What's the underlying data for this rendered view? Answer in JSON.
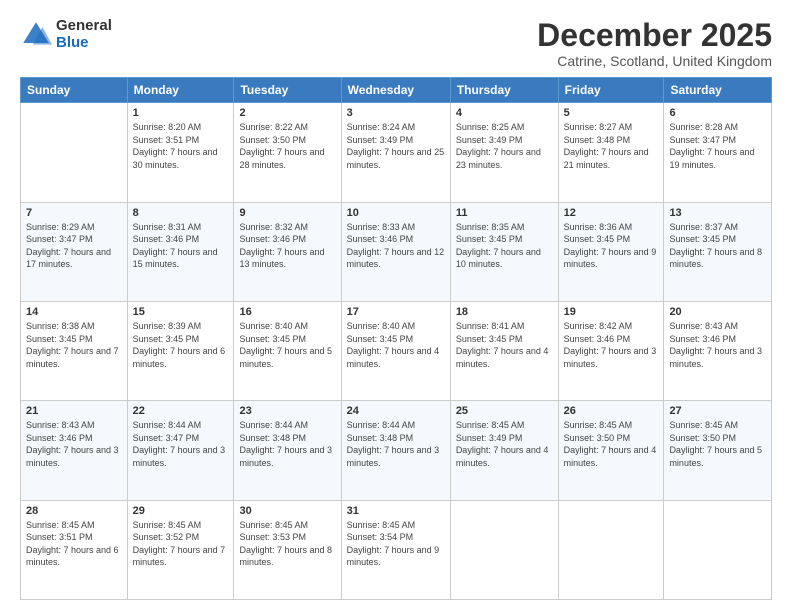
{
  "logo": {
    "general": "General",
    "blue": "Blue"
  },
  "header": {
    "title": "December 2025",
    "subtitle": "Catrine, Scotland, United Kingdom"
  },
  "days": [
    "Sunday",
    "Monday",
    "Tuesday",
    "Wednesday",
    "Thursday",
    "Friday",
    "Saturday"
  ],
  "weeks": [
    [
      {
        "day": "",
        "sunrise": "",
        "sunset": "",
        "daylight": ""
      },
      {
        "day": "1",
        "sunrise": "Sunrise: 8:20 AM",
        "sunset": "Sunset: 3:51 PM",
        "daylight": "Daylight: 7 hours and 30 minutes."
      },
      {
        "day": "2",
        "sunrise": "Sunrise: 8:22 AM",
        "sunset": "Sunset: 3:50 PM",
        "daylight": "Daylight: 7 hours and 28 minutes."
      },
      {
        "day": "3",
        "sunrise": "Sunrise: 8:24 AM",
        "sunset": "Sunset: 3:49 PM",
        "daylight": "Daylight: 7 hours and 25 minutes."
      },
      {
        "day": "4",
        "sunrise": "Sunrise: 8:25 AM",
        "sunset": "Sunset: 3:49 PM",
        "daylight": "Daylight: 7 hours and 23 minutes."
      },
      {
        "day": "5",
        "sunrise": "Sunrise: 8:27 AM",
        "sunset": "Sunset: 3:48 PM",
        "daylight": "Daylight: 7 hours and 21 minutes."
      },
      {
        "day": "6",
        "sunrise": "Sunrise: 8:28 AM",
        "sunset": "Sunset: 3:47 PM",
        "daylight": "Daylight: 7 hours and 19 minutes."
      }
    ],
    [
      {
        "day": "7",
        "sunrise": "Sunrise: 8:29 AM",
        "sunset": "Sunset: 3:47 PM",
        "daylight": "Daylight: 7 hours and 17 minutes."
      },
      {
        "day": "8",
        "sunrise": "Sunrise: 8:31 AM",
        "sunset": "Sunset: 3:46 PM",
        "daylight": "Daylight: 7 hours and 15 minutes."
      },
      {
        "day": "9",
        "sunrise": "Sunrise: 8:32 AM",
        "sunset": "Sunset: 3:46 PM",
        "daylight": "Daylight: 7 hours and 13 minutes."
      },
      {
        "day": "10",
        "sunrise": "Sunrise: 8:33 AM",
        "sunset": "Sunset: 3:46 PM",
        "daylight": "Daylight: 7 hours and 12 minutes."
      },
      {
        "day": "11",
        "sunrise": "Sunrise: 8:35 AM",
        "sunset": "Sunset: 3:45 PM",
        "daylight": "Daylight: 7 hours and 10 minutes."
      },
      {
        "day": "12",
        "sunrise": "Sunrise: 8:36 AM",
        "sunset": "Sunset: 3:45 PM",
        "daylight": "Daylight: 7 hours and 9 minutes."
      },
      {
        "day": "13",
        "sunrise": "Sunrise: 8:37 AM",
        "sunset": "Sunset: 3:45 PM",
        "daylight": "Daylight: 7 hours and 8 minutes."
      }
    ],
    [
      {
        "day": "14",
        "sunrise": "Sunrise: 8:38 AM",
        "sunset": "Sunset: 3:45 PM",
        "daylight": "Daylight: 7 hours and 7 minutes."
      },
      {
        "day": "15",
        "sunrise": "Sunrise: 8:39 AM",
        "sunset": "Sunset: 3:45 PM",
        "daylight": "Daylight: 7 hours and 6 minutes."
      },
      {
        "day": "16",
        "sunrise": "Sunrise: 8:40 AM",
        "sunset": "Sunset: 3:45 PM",
        "daylight": "Daylight: 7 hours and 5 minutes."
      },
      {
        "day": "17",
        "sunrise": "Sunrise: 8:40 AM",
        "sunset": "Sunset: 3:45 PM",
        "daylight": "Daylight: 7 hours and 4 minutes."
      },
      {
        "day": "18",
        "sunrise": "Sunrise: 8:41 AM",
        "sunset": "Sunset: 3:45 PM",
        "daylight": "Daylight: 7 hours and 4 minutes."
      },
      {
        "day": "19",
        "sunrise": "Sunrise: 8:42 AM",
        "sunset": "Sunset: 3:46 PM",
        "daylight": "Daylight: 7 hours and 3 minutes."
      },
      {
        "day": "20",
        "sunrise": "Sunrise: 8:43 AM",
        "sunset": "Sunset: 3:46 PM",
        "daylight": "Daylight: 7 hours and 3 minutes."
      }
    ],
    [
      {
        "day": "21",
        "sunrise": "Sunrise: 8:43 AM",
        "sunset": "Sunset: 3:46 PM",
        "daylight": "Daylight: 7 hours and 3 minutes."
      },
      {
        "day": "22",
        "sunrise": "Sunrise: 8:44 AM",
        "sunset": "Sunset: 3:47 PM",
        "daylight": "Daylight: 7 hours and 3 minutes."
      },
      {
        "day": "23",
        "sunrise": "Sunrise: 8:44 AM",
        "sunset": "Sunset: 3:48 PM",
        "daylight": "Daylight: 7 hours and 3 minutes."
      },
      {
        "day": "24",
        "sunrise": "Sunrise: 8:44 AM",
        "sunset": "Sunset: 3:48 PM",
        "daylight": "Daylight: 7 hours and 3 minutes."
      },
      {
        "day": "25",
        "sunrise": "Sunrise: 8:45 AM",
        "sunset": "Sunset: 3:49 PM",
        "daylight": "Daylight: 7 hours and 4 minutes."
      },
      {
        "day": "26",
        "sunrise": "Sunrise: 8:45 AM",
        "sunset": "Sunset: 3:50 PM",
        "daylight": "Daylight: 7 hours and 4 minutes."
      },
      {
        "day": "27",
        "sunrise": "Sunrise: 8:45 AM",
        "sunset": "Sunset: 3:50 PM",
        "daylight": "Daylight: 7 hours and 5 minutes."
      }
    ],
    [
      {
        "day": "28",
        "sunrise": "Sunrise: 8:45 AM",
        "sunset": "Sunset: 3:51 PM",
        "daylight": "Daylight: 7 hours and 6 minutes."
      },
      {
        "day": "29",
        "sunrise": "Sunrise: 8:45 AM",
        "sunset": "Sunset: 3:52 PM",
        "daylight": "Daylight: 7 hours and 7 minutes."
      },
      {
        "day": "30",
        "sunrise": "Sunrise: 8:45 AM",
        "sunset": "Sunset: 3:53 PM",
        "daylight": "Daylight: 7 hours and 8 minutes."
      },
      {
        "day": "31",
        "sunrise": "Sunrise: 8:45 AM",
        "sunset": "Sunset: 3:54 PM",
        "daylight": "Daylight: 7 hours and 9 minutes."
      },
      {
        "day": "",
        "sunrise": "",
        "sunset": "",
        "daylight": ""
      },
      {
        "day": "",
        "sunrise": "",
        "sunset": "",
        "daylight": ""
      },
      {
        "day": "",
        "sunrise": "",
        "sunset": "",
        "daylight": ""
      }
    ]
  ]
}
